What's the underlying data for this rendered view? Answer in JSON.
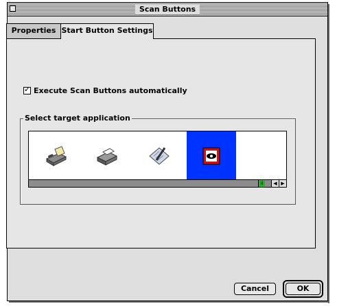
{
  "window": {
    "title": "Scan Buttons"
  },
  "tabs": [
    {
      "label": "Properties",
      "active": false
    },
    {
      "label": "Start Button Settings",
      "active": true
    }
  ],
  "auto_option": {
    "label": "Execute Scan Buttons automatically",
    "checked": true
  },
  "target_group": {
    "label": "Select target application",
    "apps": [
      {
        "icon": "fax-icon",
        "selected": false
      },
      {
        "icon": "printer-icon",
        "selected": false
      },
      {
        "icon": "document-edit-icon",
        "selected": false
      },
      {
        "icon": "eye-application-icon",
        "selected": true
      }
    ]
  },
  "buttons": {
    "cancel": "Cancel",
    "ok": "OK"
  },
  "colors": {
    "selection": "#0033ff",
    "scroll_thumb": "#28b428",
    "window_bg": "#dedede"
  }
}
